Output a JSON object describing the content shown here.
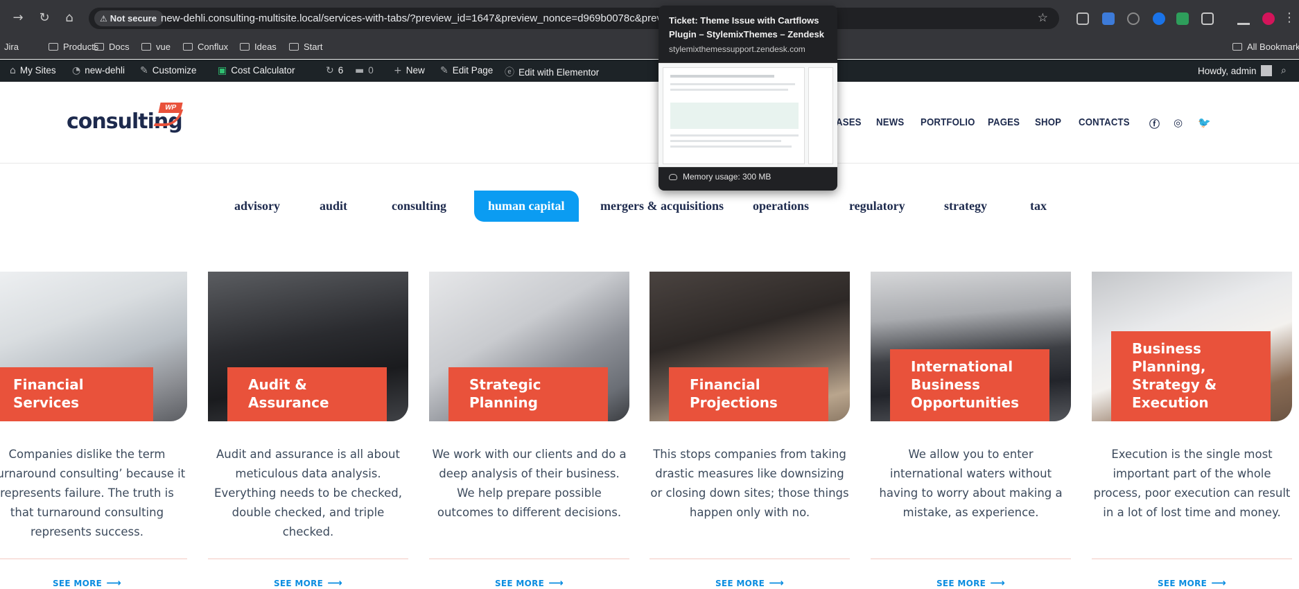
{
  "browser": {
    "not_secure_label": "Not secure",
    "url": "new-dehli.consulting-multisite.local/services-with-tabs/?preview_id=1647&preview_nonce=d969b0078c&preview=tr",
    "bookmarks": [
      "Jira",
      "Products",
      "Docs",
      "vue",
      "Conflux",
      "Ideas",
      "Start"
    ],
    "all_bookmarks_label": "All Bookmarks"
  },
  "tooltip": {
    "title": "Ticket: Theme Issue with Cartflows Plugin – StylemixThemes – Zendesk",
    "domain": "stylemixthemessupport.zendesk.com",
    "memory": "Memory usage: 300 MB"
  },
  "adminbar": {
    "my_sites": "My Sites",
    "site_name": "new-dehli",
    "customize": "Customize",
    "cost_calculator": "Cost Calculator",
    "updates_count": "6",
    "comments_count": "0",
    "new_label": "New",
    "edit_page": "Edit Page",
    "edit_elementor": "Edit with Elementor",
    "howdy": "Howdy, admin"
  },
  "header": {
    "logo_text": "consulting",
    "logo_badge": "WP",
    "menu": [
      "ASES",
      "NEWS",
      "PORTFOLIO",
      "PAGES",
      "SHOP",
      "CONTACTS"
    ],
    "social_icons": [
      "facebook-icon",
      "instagram-icon",
      "twitter-icon"
    ]
  },
  "tabs": [
    {
      "label": "advisory",
      "active": false
    },
    {
      "label": "audit",
      "active": false
    },
    {
      "label": "consulting",
      "active": false
    },
    {
      "label": "human capital",
      "active": true
    },
    {
      "label": "mergers & acquisitions",
      "active": false
    },
    {
      "label": "operations",
      "active": false
    },
    {
      "label": "regulatory",
      "active": false
    },
    {
      "label": "strategy",
      "active": false
    },
    {
      "label": "tax",
      "active": false
    }
  ],
  "cards": [
    {
      "title": "Financial Services",
      "desc": "Companies dislike the term ‘turnaround consulting’ because it represents failure. The truth is that turnaround consulting represents success.",
      "cta": "SEE MORE"
    },
    {
      "title": "Audit & Assurance",
      "desc": "Audit and assurance is all about meticulous data analysis. Everything needs to be checked, double checked, and triple checked.",
      "cta": "SEE MORE"
    },
    {
      "title": "Strategic Planning",
      "desc": "We work with our clients and do a deep analysis of their business. We help prepare possible outcomes to different decisions.",
      "cta": "SEE MORE"
    },
    {
      "title": "Financial Projections",
      "desc": "This stops companies from taking drastic measures like downsizing or closing down sites; those things happen only with no.",
      "cta": "SEE MORE"
    },
    {
      "title": "International Business Opportunities",
      "desc": "We allow you to enter international waters without having to worry about making a mistake, as experience.",
      "cta": "SEE MORE"
    },
    {
      "title": "Business Planning, Strategy & Execution",
      "desc": "Execution is the single most important part of the whole process, poor execution can result in a lot of lost time and money.",
      "cta": "SEE MORE"
    }
  ],
  "colors": {
    "accent": "#e9523b",
    "tab_active": "#0b9cf2",
    "navy": "#1d2a4d",
    "link": "#0b8de0"
  }
}
